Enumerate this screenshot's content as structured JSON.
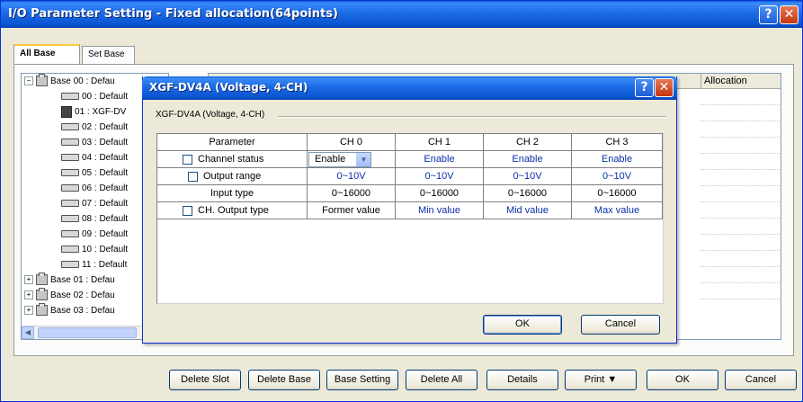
{
  "window": {
    "title": "I/O Parameter Setting - Fixed allocation(64points)",
    "help_glyph": "?",
    "close_glyph": "✕"
  },
  "tabs": [
    {
      "label": "All Base",
      "active": true
    },
    {
      "label": "Set Base",
      "active": false
    }
  ],
  "tree": {
    "base00": "Base 00 : Defau",
    "slots": [
      "00 : Default",
      "01 : XGF-DV",
      "02 : Default",
      "03 : Default",
      "04 : Default",
      "05 : Default",
      "06 : Default",
      "07 : Default",
      "08 : Default",
      "09 : Default",
      "10 : Default",
      "11 : Default"
    ],
    "bases": [
      "Base 01 : Defau",
      "Base 02 : Defau",
      "Base 03 : Defau"
    ],
    "expand_plus": "+",
    "expand_minus": "−"
  },
  "grid": {
    "allocation_header": "Allocation"
  },
  "bottom_buttons": {
    "delete_slot": "Delete Slot",
    "delete_base": "Delete Base",
    "base_setting": "Base Setting",
    "delete_all": "Delete All",
    "details": "Details",
    "print": "Print  ▼",
    "ok": "OK",
    "cancel": "Cancel"
  },
  "dialog": {
    "title": "XGF-DV4A (Voltage, 4-CH)",
    "description": "XGF-DV4A (Voltage, 4-CH)",
    "help_glyph": "?",
    "close_glyph": "✕",
    "headers": [
      "Parameter",
      "CH 0",
      "CH 1",
      "CH 2",
      "CH 3"
    ],
    "rows": [
      {
        "param": "Channel status",
        "values": [
          "Enable",
          "Enable",
          "Enable",
          "Enable"
        ]
      },
      {
        "param": "Output range",
        "values": [
          "0~10V",
          "0~10V",
          "0~10V",
          "0~10V"
        ]
      },
      {
        "param": "Input type",
        "values": [
          "0~16000",
          "0~16000",
          "0~16000",
          "0~16000"
        ]
      },
      {
        "param": "CH. Output type",
        "values": [
          "Former value",
          "Min value",
          "Mid value",
          "Max value"
        ]
      }
    ],
    "combo_arrow": "▼",
    "ok_label": "OK",
    "cancel_label": "Cancel"
  },
  "colors": {
    "titlebar": "#0a54d0",
    "dialog_bg": "#ece9d8",
    "value_blue": "#0b2fa8"
  }
}
